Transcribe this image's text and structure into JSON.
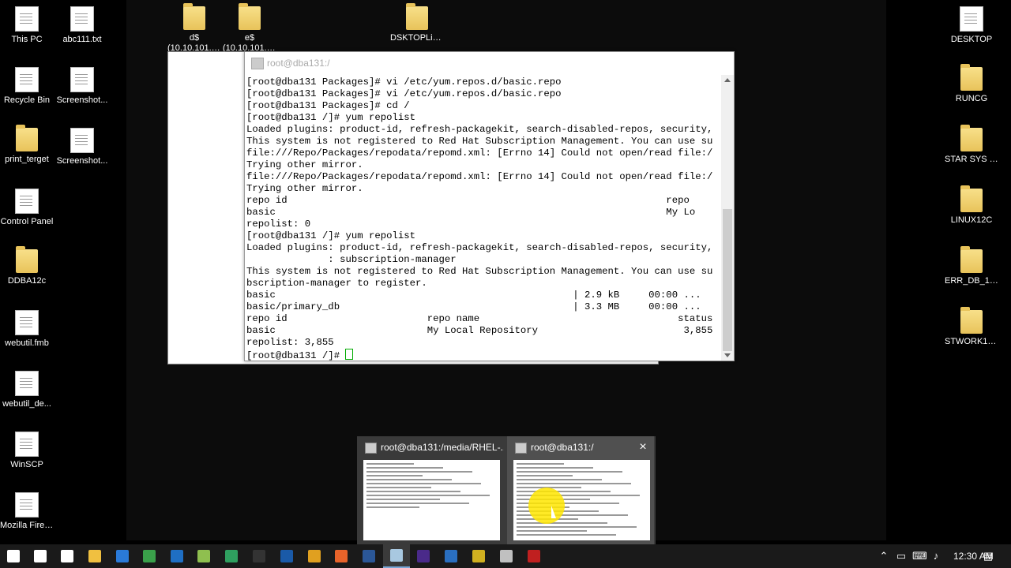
{
  "desktop": {
    "left_icons": [
      {
        "label": "This PC",
        "icon": "this-pc-icon"
      },
      {
        "label": "abc111.txt",
        "icon": "text-file-icon"
      },
      {
        "label": "Recycle Bin",
        "icon": "recycle-bin-icon"
      },
      {
        "label": "Screenshot...",
        "icon": "image-file-icon"
      },
      {
        "label": "print_terget",
        "icon": "folder-icon"
      },
      {
        "label": "Screenshot...",
        "icon": "image-file-icon"
      },
      {
        "label": "Control Panel",
        "icon": "control-panel-icon"
      },
      {
        "label": "DDBA12c",
        "icon": "folder-icon"
      },
      {
        "label": "webutil.fmb",
        "icon": "form-file-icon"
      },
      {
        "label": "webutil_de...",
        "icon": "form-file-icon"
      },
      {
        "label": "WinSCP",
        "icon": "winscp-icon"
      },
      {
        "label": "Mozilla Firefox",
        "icon": "firefox-icon"
      }
    ],
    "top_icons": [
      {
        "label": "d$",
        "sublabel": "(10.10.101.1...",
        "icon": "network-drive-icon"
      },
      {
        "label": "e$",
        "sublabel": "(10.10.101.1...",
        "icon": "network-drive-icon"
      },
      {
        "label": "DSKTOPLinux",
        "icon": "folder-icon"
      }
    ],
    "right_icons": [
      {
        "label": "DESKTOP",
        "icon": "file-icon"
      },
      {
        "label": "RUNCG",
        "icon": "folder-icon"
      },
      {
        "label": "STAR SYS 12",
        "icon": "folder-icon"
      },
      {
        "label": "LINUX12C",
        "icon": "folder-icon"
      },
      {
        "label": "ERR_DB_12C",
        "icon": "folder-icon"
      },
      {
        "label": "STWORK12C",
        "icon": "folder-icon"
      }
    ]
  },
  "putty": {
    "title": "root@dba131:/",
    "lines": [
      "[root@dba131 Packages]# vi /etc/yum.repos.d/basic.repo",
      "[root@dba131 Packages]# vi /etc/yum.repos.d/basic.repo",
      "[root@dba131 Packages]# cd /",
      "[root@dba131 /]# yum repolist",
      "Loaded plugins: product-id, refresh-packagekit, search-disabled-repos, security,",
      "This system is not registered to Red Hat Subscription Management. You can use su",
      "file:///Repo/Packages/repodata/repomd.xml: [Errno 14] Could not open/read file:/",
      "Trying other mirror.",
      "file:///Repo/Packages/repodata/repomd.xml: [Errno 14] Could not open/read file:/",
      "Trying other mirror.",
      "repo id                                                                 repo",
      "basic                                                                   My Lo",
      "repolist: 0",
      "[root@dba131 /]# yum repolist",
      "Loaded plugins: product-id, refresh-packagekit, search-disabled-repos, security,",
      "              : subscription-manager",
      "This system is not registered to Red Hat Subscription Management. You can use su",
      "bscription-manager to register.",
      "basic                                                   | 2.9 kB     00:00 ...",
      "basic/primary_db                                        | 3.3 MB     00:00 ...",
      "repo id                        repo name                                  status",
      "basic                          My Local Repository                         3,855",
      "repolist: 3,855"
    ],
    "prompt": "[root@dba131 /]# "
  },
  "previews": [
    {
      "title": "root@dba131:/media/RHEL-..."
    },
    {
      "title": "root@dba131:/",
      "close": "×"
    }
  ],
  "taskbar": {
    "clock": "12:30 AM",
    "apps": [
      {
        "icon": "start-icon",
        "color": "#ffffff"
      },
      {
        "icon": "search-icon",
        "color": "#ffffff"
      },
      {
        "icon": "task-view-icon",
        "color": "#ffffff"
      },
      {
        "icon": "file-explorer-icon",
        "color": "#f0c040"
      },
      {
        "icon": "app-blue-icon",
        "color": "#2a7ad8"
      },
      {
        "icon": "app-green-icon",
        "color": "#3aa04a"
      },
      {
        "icon": "outlook-icon",
        "color": "#1f6fc4"
      },
      {
        "icon": "notepad-icon",
        "color": "#8fbf4f"
      },
      {
        "icon": "app-green2-icon",
        "color": "#2f9f5f"
      },
      {
        "icon": "cmd-icon",
        "color": "#333333"
      },
      {
        "icon": "app-window-icon",
        "color": "#1a5aa8"
      },
      {
        "icon": "chrome-icon",
        "color": "#e0a020"
      },
      {
        "icon": "firefox-icon",
        "color": "#e8632a"
      },
      {
        "icon": "word-icon",
        "color": "#2b5797"
      },
      {
        "icon": "putty-icon",
        "color": "#a8c8e0"
      },
      {
        "icon": "app-vs-icon",
        "color": "#4a2a8a"
      },
      {
        "icon": "app-doc-icon",
        "color": "#2a6fc0"
      },
      {
        "icon": "app-yellow-icon",
        "color": "#d0b020"
      },
      {
        "icon": "putty2-icon",
        "color": "#c0c0c0"
      },
      {
        "icon": "app-red-icon",
        "color": "#c02020"
      }
    ]
  }
}
